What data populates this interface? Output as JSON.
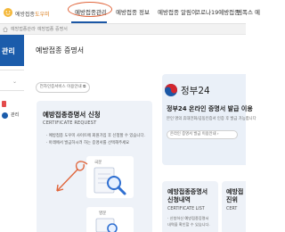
{
  "header": {
    "logo": {
      "text": "예방접종",
      "highlight": "도우미",
      "icon": "smile-sun-logo-icon"
    },
    "nav": [
      {
        "label": "예방접종관리",
        "active": true
      },
      {
        "label": "예방접종 정보",
        "active": false
      },
      {
        "label": "예방접종 알림이",
        "active": false
      },
      {
        "label": "코로나19예방접종",
        "active": false
      },
      {
        "label": "엠폭스 예"
      }
    ],
    "annotation_color": "#e0663c",
    "accent": "#1b57a5"
  },
  "breadcrumb": {
    "home_icon": "home-icon",
    "items": [
      "예방접종관리",
      "예방접종 증명서"
    ]
  },
  "sidebar": {
    "title": "관리",
    "items": [
      {
        "chevron": "chevron-down-icon"
      },
      {
        "icon": "document-icon"
      },
      {
        "text": "관리"
      }
    ]
  },
  "main": {
    "page_title": "예방접종 증명서",
    "info_button": "전자인증서비스 이용안내",
    "left_card": {
      "title": "예방접종증명서 신청",
      "subtitle": "CERTIFICATE REQUEST",
      "notes": [
        "· 예방접종 도우미 사이트에 회원가입 후 신청할 수 있습니다.",
        "· 아래에서 발급하시려 하는 증명서를 선택해주세요"
      ],
      "option1_label": "국문",
      "option2_label": "영문"
    },
    "right_card": {
      "emblem": "taegeuk-emblem-icon",
      "brand": "정부24",
      "title": "정부24 온라인 증명서 발급 이용",
      "desc": "본인 명의 휴대전화/공동인증서 인증 후 발급 가능합니다",
      "button": "온라인 증명서 발급 이용안내 ›"
    },
    "card2": {
      "title_lines": [
        "예방접종증명서",
        "신청내역"
      ],
      "subtitle": "CERTIFICATE LIST",
      "notes": [
        "· 신청하신 예방접종증명서",
        "  내역을 확인할 수 있습니다."
      ]
    },
    "card3": {
      "title_lines": [
        "예방접",
        "진위"
      ],
      "subtitle": "CERT"
    }
  }
}
